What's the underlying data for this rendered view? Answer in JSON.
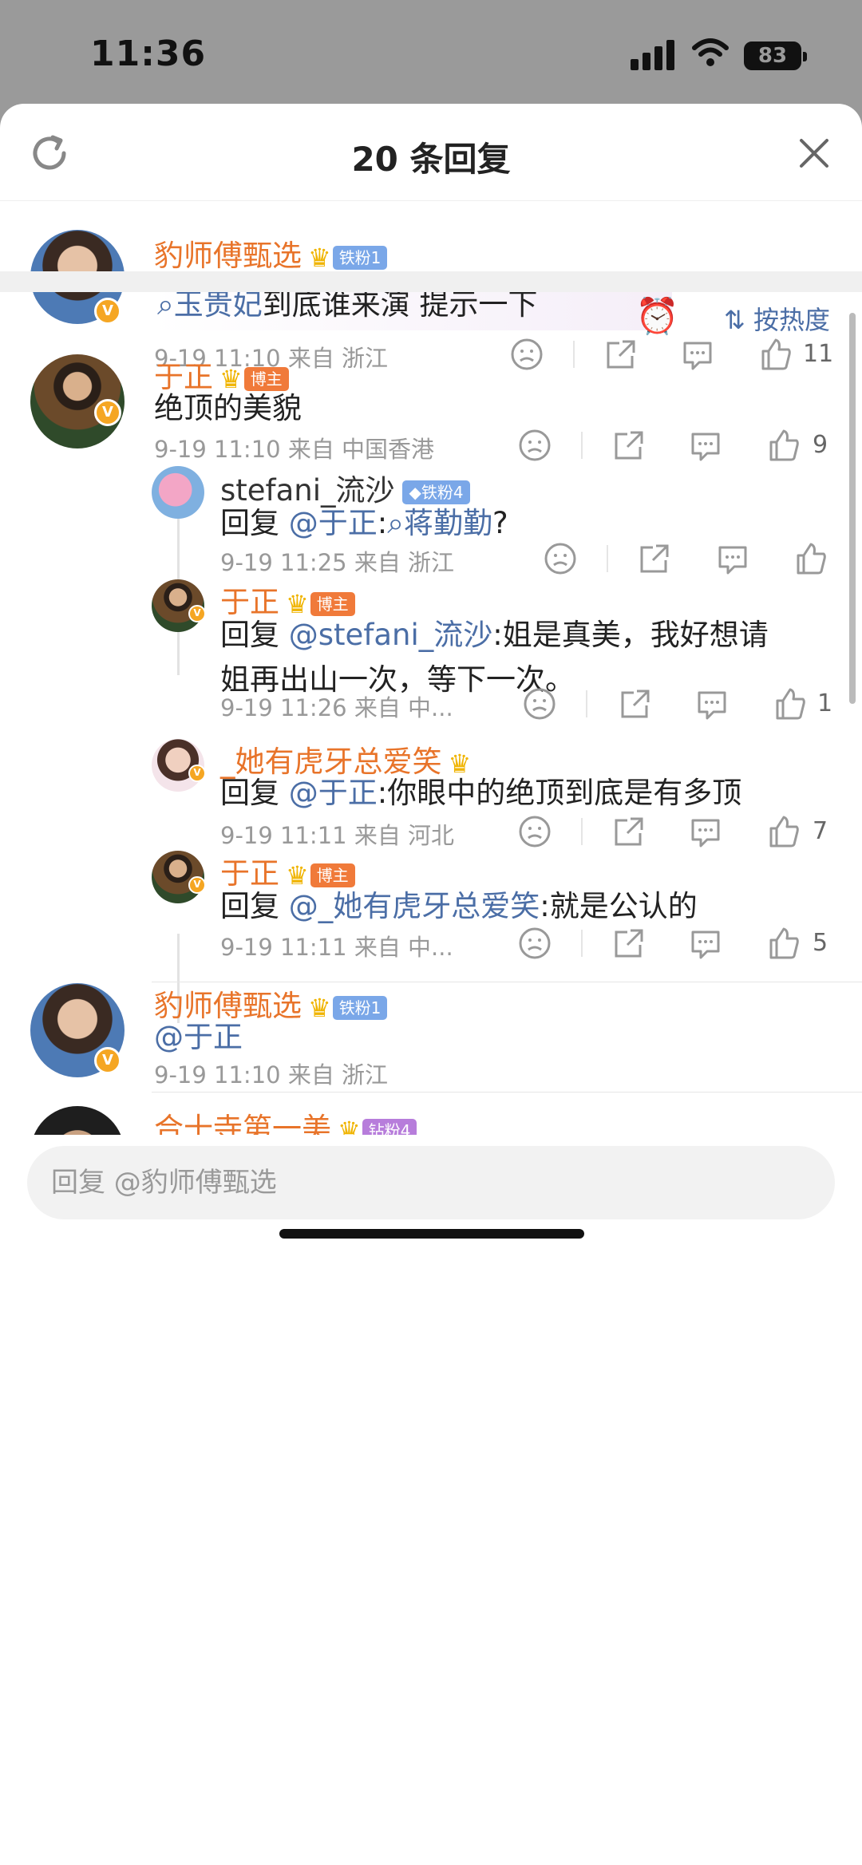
{
  "status_bar": {
    "time": "11:36",
    "battery": "83"
  },
  "sheet": {
    "title": "20 条回复",
    "input_placeholder": "回复 @豹师傅甄选",
    "sort_label": "按热度"
  },
  "root_comment": {
    "user": "豹师傅甄选",
    "fan_tag": "铁粉1",
    "search_term": "玉贵妃",
    "text_rest": "到底谁来演 提示一下",
    "meta": "9-19 11:10 来自 浙江",
    "likes": "11"
  },
  "comments": [
    {
      "user": "于正",
      "tag": "博主",
      "text": "绝顶的美貌",
      "meta": "9-19 11:10 来自 中国香港",
      "likes": "9"
    },
    {
      "user": "stefani_流沙",
      "tag": "铁粉4",
      "reply_prefix": "回复 ",
      "mention": "@于正",
      "colon": ":",
      "search_term": "蒋勤勤",
      "tail": "?",
      "meta": "9-19 11:25 来自 浙江",
      "likes": ""
    },
    {
      "user": "于正",
      "tag": "博主",
      "reply_prefix": "回复 ",
      "mention": "@stefani_流沙",
      "line1_rest": ":姐是真美，我好想请",
      "line2": "姐再出山一次，等下一次。",
      "meta": "9-19 11:26 来自 中...",
      "likes": "1"
    },
    {
      "user": "_她有虎牙总爱笑",
      "reply_prefix": "回复 ",
      "mention": "@于正",
      "rest": ":你眼中的绝顶到底是有多顶",
      "meta": "9-19 11:11 来自 河北",
      "likes": "7"
    },
    {
      "user": "于正",
      "tag": "博主",
      "reply_prefix": "回复 ",
      "mention": "@_她有虎牙总爱笑",
      "rest": ":就是公认的",
      "meta": "9-19 11:11 来自 中...",
      "likes": "5"
    },
    {
      "user": "豹师傅甄选",
      "tag": "铁粉1",
      "mention": "@于正",
      "meta": "9-19 11:10 来自 浙江"
    },
    {
      "user": "合十寺第一美",
      "tag": "钻粉4"
    }
  ]
}
